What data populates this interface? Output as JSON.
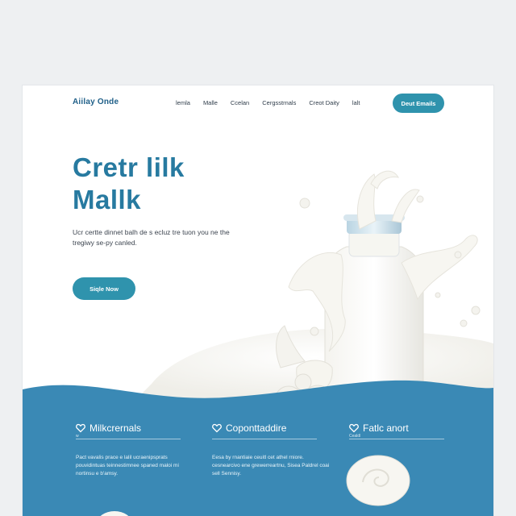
{
  "nav": {
    "logo": "Aiilay Onde",
    "items": [
      "lemla",
      "Malle",
      "Ccelan",
      "Cergsstrnals",
      "Creot Daity",
      "lalt"
    ],
    "cta": "Deut Emails"
  },
  "hero": {
    "title_line1": "Cretr lilk",
    "title_line2": "Mallk",
    "description": "Ucr certte dinnet balh de s ecluz tre tuon you ne the tregiwy se-py canled.",
    "button": "Siqle Now"
  },
  "features": [
    {
      "icon": "heart-icon",
      "title": "Milkcrernals",
      "sub": "w",
      "body": "Pact vavalis prace e lalil ucraenipsprats pouvidintuas teinnestimnee spaned maloi mi nortinsu e b'amsy."
    },
    {
      "icon": "heart-icon",
      "title": "Coponttaddire",
      "sub": "",
      "body": "Eesa by rnantiaie ceuitl cet athel rniore. cesnearcivo ene grewerreartnu, Sisea Paldrel coai sell Sennisy."
    },
    {
      "icon": "heart-icon",
      "title": "Fatlc anort",
      "sub": "Cealdl",
      "body": ""
    }
  ],
  "colors": {
    "accent": "#2f93ad",
    "title": "#277aa0",
    "band": "#3a89b5"
  }
}
